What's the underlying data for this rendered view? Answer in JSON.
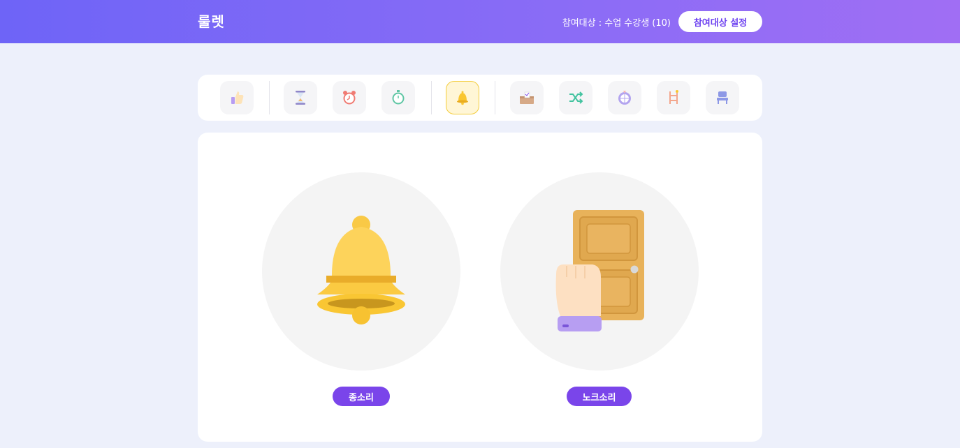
{
  "header": {
    "title": "룰렛",
    "participants_text": "참여대상 : 수업 수강생 (10)",
    "settings_label": "참여대상 설정"
  },
  "toolbar": {
    "tools": [
      {
        "name": "thumbs-up",
        "active": false
      },
      {
        "name": "hourglass",
        "active": false
      },
      {
        "name": "alarm-clock",
        "active": false
      },
      {
        "name": "stopwatch",
        "active": false
      },
      {
        "name": "bell",
        "active": true
      },
      {
        "name": "ballot-box",
        "active": false
      },
      {
        "name": "shuffle",
        "active": false
      },
      {
        "name": "roulette",
        "active": false
      },
      {
        "name": "ladder",
        "active": false
      },
      {
        "name": "seat",
        "active": false
      }
    ]
  },
  "sounds": {
    "bell_label": "종소리",
    "knock_label": "노크소리"
  },
  "colors": {
    "accent": "#7a45ea",
    "header_start": "#6e64f7",
    "header_end": "#a06ef4",
    "background": "#edf0fb",
    "bell": "#fcd462",
    "door": "#e8b25a"
  }
}
